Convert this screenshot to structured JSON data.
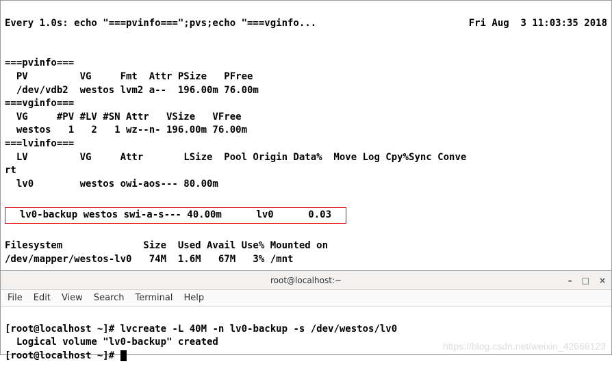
{
  "watch": {
    "interval": "Every 1.0s: echo \"===pvinfo===\";pvs;echo \"===vginfo...",
    "timestamp": "Fri Aug  3 11:03:35 2018"
  },
  "pvinfo": {
    "marker": "===pvinfo===",
    "header": "  PV         VG     Fmt  Attr PSize   PFree",
    "row": "  /dev/vdb2  westos lvm2 a--  196.00m 76.00m"
  },
  "vginfo": {
    "marker": "===vginfo===",
    "header": "  VG     #PV #LV #SN Attr   VSize   VFree",
    "row": "  westos   1   2   1 wz--n- 196.00m 76.00m"
  },
  "lvinfo": {
    "marker": "===lvinfo===",
    "header1": "  LV         VG     Attr       LSize  Pool Origin Data%  Move Log Cpy%Sync Conve",
    "header2": "rt",
    "row1": "  lv0        westos owi-aos--- 80.00m",
    "highlight": "  lv0-backup westos swi-a-s--- 40.00m      lv0      0.03  "
  },
  "df": {
    "header": "Filesystem              Size  Used Avail Use% Mounted on",
    "row": "/dev/mapper/westos-lv0   74M  1.6M   67M   3% /mnt"
  },
  "titlebar": {
    "title": "root@localhost:~"
  },
  "menubar": {
    "file": "File",
    "edit": "Edit",
    "view": "View",
    "search": "Search",
    "terminal": "Terminal",
    "help": "Help"
  },
  "terminal": {
    "prompt1": "[root@localhost ~]# ",
    "cmd1": "lvcreate -L 40M -n lv0-backup -s /dev/westos/lv0",
    "out1": "  Logical volume \"lv0-backup\" created",
    "prompt2": "[root@localhost ~]# "
  },
  "watermark": "https://blog.csdn.net/weixin_42668123"
}
